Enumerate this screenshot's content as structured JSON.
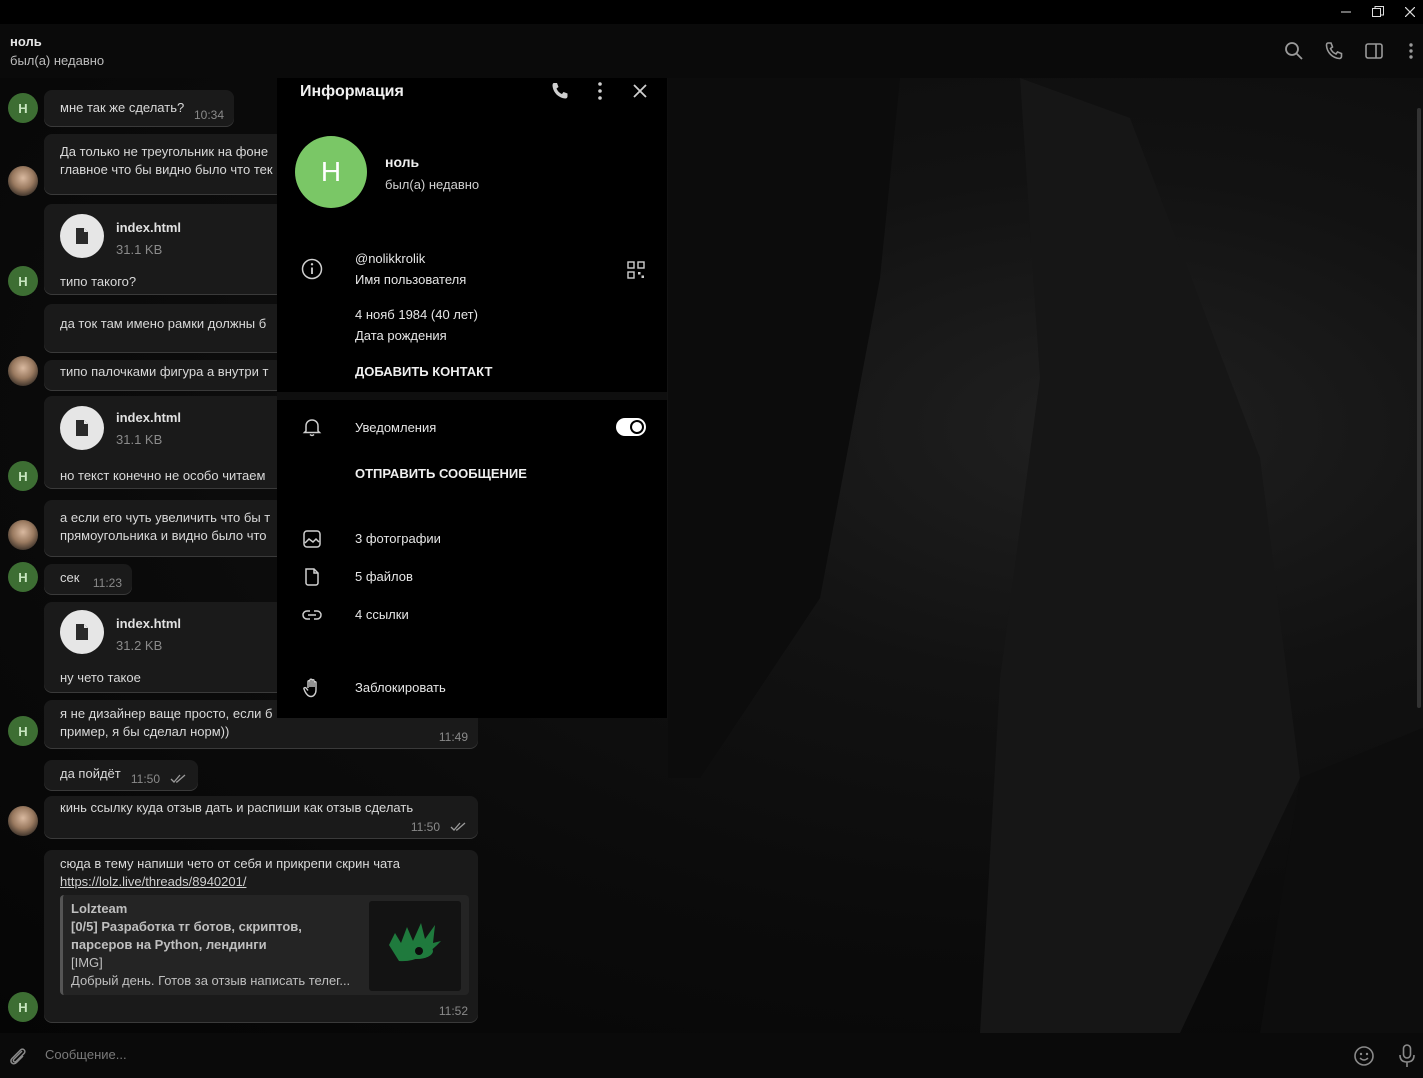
{
  "header": {
    "name": "ноль",
    "status": "был(а) недавно"
  },
  "messages": [
    {
      "text": "мне так же сделать?",
      "time": "10:34"
    },
    {
      "line1": "Да только не треугольник на фоне",
      "line2": "главное что бы видно было что тек"
    },
    {
      "file_name": "index.html",
      "file_size": "31.1 KB",
      "caption": "типо такого?"
    },
    {
      "text": "да ток там имено рамки должны б"
    },
    {
      "text": "типо палочками фигура а внутри т"
    },
    {
      "file_name": "index.html",
      "file_size": "31.1 KB",
      "caption": "но текст конечно не особо читаем"
    },
    {
      "line1": "а если его чуть увеличить что бы т",
      "line2": "прямоугольника и видно было что"
    },
    {
      "text": "сек",
      "time": "11:23"
    },
    {
      "file_name": "index.html",
      "file_size": "31.2 KB",
      "caption": "ну чето такое"
    },
    {
      "line1": "я не дизайнер ваще просто, если б",
      "line2": "пример, я бы сделал норм))",
      "time": "11:49"
    },
    {
      "text": "да пойдёт",
      "time": "11:50"
    },
    {
      "text": "кинь ссылку куда отзыв дать и распиши как отзыв сделать",
      "time": "11:50"
    },
    {
      "line1": "сюда в тему напиши чето от себя и прикрепи скрин чата",
      "link": "https://lolz.live/threads/8940201/",
      "time": "11:52",
      "preview": {
        "site": "Lolzteam",
        "title1": "[0/5] Разработка тг ботов, скриптов,",
        "title2": "парсеров на Python, лендинги",
        "tag": "[IMG]",
        "desc": "Добрый день. Готов за отзыв написать телег..."
      }
    }
  ],
  "avatar_letter": "Н",
  "input": {
    "placeholder": "Сообщение..."
  },
  "panel": {
    "title": "Информация",
    "avatar_letter": "Н",
    "name": "ноль",
    "status": "был(а) недавно",
    "username": "@nolikkrolik",
    "username_label": "Имя пользователя",
    "birthday": "4 нояб 1984 (40 лет)",
    "birthday_label": "Дата рождения",
    "add_contact": "ДОБАВИТЬ КОНТАКТ",
    "notifications": "Уведомления",
    "notifications_on": true,
    "send_message": "ОТПРАВИТЬ СООБЩЕНИЕ",
    "photos": "3 фотографии",
    "files": "5 файлов",
    "links": "4 ссылки",
    "block": "Заблокировать"
  },
  "colors": {
    "avatar_green": "#7ac766",
    "small_avatar_green": "#3d6e33"
  }
}
